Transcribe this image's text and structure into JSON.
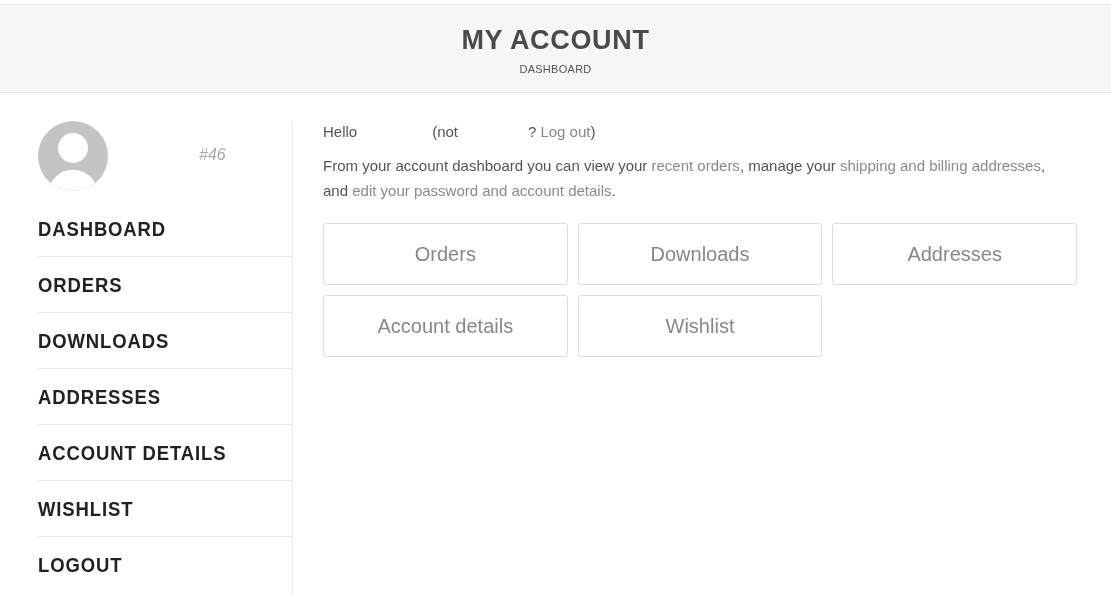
{
  "header": {
    "title": "MY ACCOUNT",
    "breadcrumb": "DASHBOARD"
  },
  "profile": {
    "user_number": "#46"
  },
  "menu": [
    {
      "label": "DASHBOARD"
    },
    {
      "label": "ORDERS"
    },
    {
      "label": "DOWNLOADS"
    },
    {
      "label": "ADDRESSES"
    },
    {
      "label": "ACCOUNT DETAILS"
    },
    {
      "label": "WISHLIST"
    },
    {
      "label": "LOGOUT"
    }
  ],
  "greeting": {
    "hello": "Hello",
    "not": "(not",
    "logout_prefix": "?",
    "logout_link": "Log out",
    "logout_suffix": ")"
  },
  "intro": [
    {
      "text": "From your account dashboard you can view your ",
      "link": false
    },
    {
      "text": "recent orders",
      "link": true
    },
    {
      "text": ", manage your ",
      "link": false
    },
    {
      "text": "shipping and billing addresses",
      "link": true
    },
    {
      "text": ", ",
      "link": false
    },
    {
      "text": "and ",
      "link": false
    },
    {
      "text": "edit your password and account details",
      "link": true
    },
    {
      "text": ".",
      "link": false
    }
  ],
  "tiles": [
    "Orders",
    "Downloads",
    "Addresses",
    "Account details",
    "Wishlist"
  ]
}
